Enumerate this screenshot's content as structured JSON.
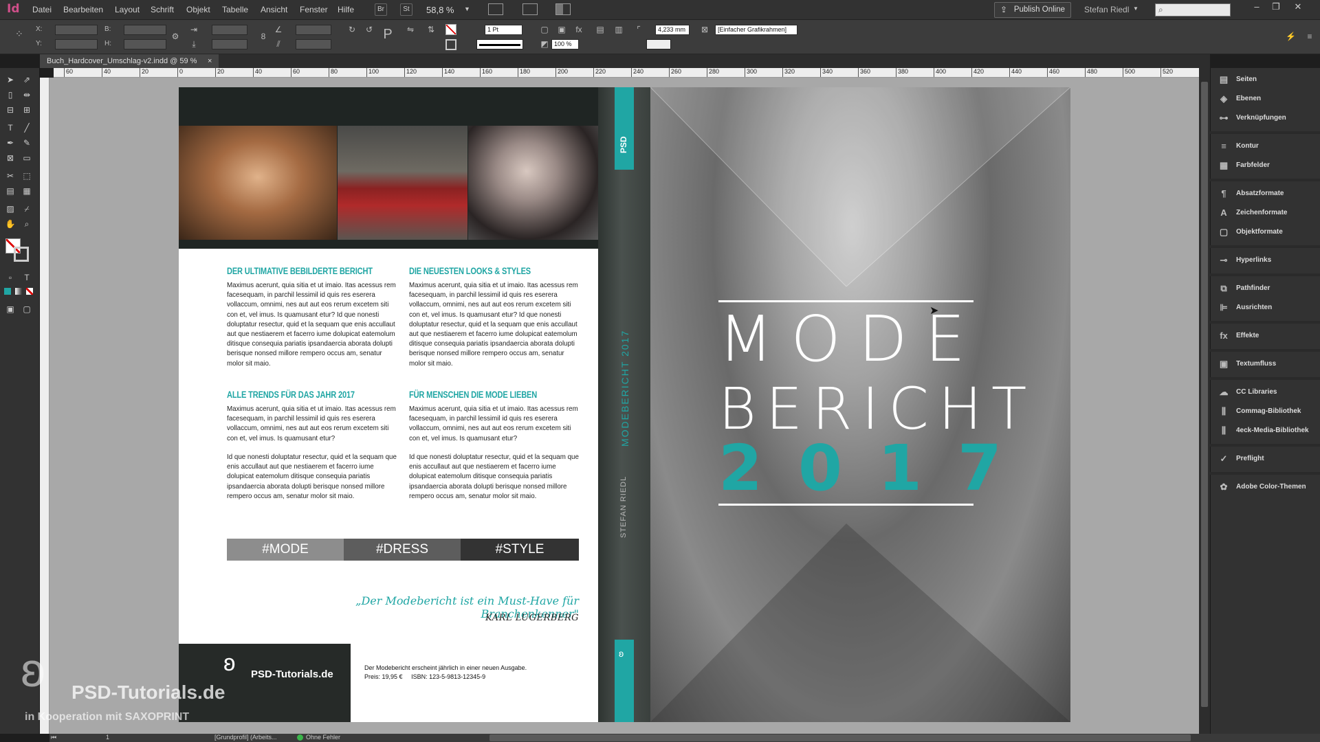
{
  "app": {
    "logo": "Id"
  },
  "menu": [
    "Datei",
    "Bearbeiten",
    "Layout",
    "Schrift",
    "Objekt",
    "Tabelle",
    "Ansicht",
    "Fenster",
    "Hilfe"
  ],
  "menubar": {
    "br_label": "Br",
    "st_label": "St",
    "zoom": "58,8 %",
    "publish": "Publish Online",
    "user": "Stefan Riedl"
  },
  "controlbar": {
    "x_label": "X:",
    "y_label": "Y:",
    "b_label": "B:",
    "h_label": "H:",
    "stroke_weight": "1 Pt",
    "dimension": "4,233 mm",
    "percent": "100 %",
    "frame_style": "[Einfacher Grafikrahmen]"
  },
  "document_tab": {
    "title": "Buch_Hardcover_Umschlag-v2.indd @ 59 %"
  },
  "ruler": {
    "ticks": [
      "60",
      "40",
      "20",
      "0",
      "20",
      "40",
      "60",
      "80",
      "100",
      "120",
      "140",
      "160",
      "180",
      "200",
      "220",
      "240",
      "260",
      "280",
      "300",
      "320",
      "340",
      "360",
      "380",
      "400",
      "420",
      "440",
      "460",
      "480",
      "500",
      "520"
    ]
  },
  "panel": {
    "items": [
      "Seiten",
      "Ebenen",
      "Verknüpfungen",
      "Kontur",
      "Farbfelder",
      "Absatzformate",
      "Zeichenformate",
      "Objektformate",
      "Hyperlinks",
      "Pathfinder",
      "Ausrichten",
      "Effekte",
      "Textumfluss",
      "CC Libraries",
      "Commag-Bibliothek",
      "4eck-Media-Bibliothek",
      "Preflight",
      "Adobe Color-Themen"
    ]
  },
  "back_cover": {
    "col1": {
      "h1": "DER ULTIMATIVE BEBILDERTE BERICHT",
      "p1": "Maximus acerunt, quia sitia et ut imaio. Itas acessus rem facesequam, in parchil lessimil id quis res eserera vollaccum, omnimi, nes aut aut eos rerum excetem siti con et, vel imus. Is quamusant etur? Id que nonesti doluptatur resectur, quid et la sequam que enis accullaut aut que nestiaerem et facerro iume dolupicat eatemolum ditisque consequia pariatis ipsandaercia aborata dolupti berisque nonsed millore rempero occus am, senatur molor sit maio.",
      "h2": "ALLE TRENDS FÜR DAS JAHR 2017",
      "p2": "Maximus acerunt, quia sitia et ut imaio. Itas acessus rem facesequam, in parchil lessimil id quis res eserera vollaccum, omnimi, nes aut aut eos rerum excetem siti con et, vel imus. Is quamusant etur?",
      "p3": "Id que nonesti doluptatur resectur, quid et la sequam que enis accullaut aut que nestiaerem et facerro iume dolupicat eatemolum ditisque consequia pariatis ipsandaercia aborata dolupti berisque nonsed millore rempero occus am, senatur molor sit maio."
    },
    "col2": {
      "h1": "DIE NEUESTEN LOOKS & STYLES",
      "p1": "Maximus acerunt, quia sitia et ut imaio. Itas acessus rem facesequam, in parchil lessimil id quis res eserera vollaccum, omnimi, nes aut aut eos rerum excetem siti con et, vel imus. Is quamusant etur? Id que nonesti doluptatur resectur, quid et la sequam que enis accullaut aut que nestiaerem et facerro iume dolupicat eatemolum ditisque consequia pariatis ipsandaercia aborata dolupti berisque nonsed millore rempero occus am, senatur molor sit maio.",
      "h2": "FÜR MENSCHEN DIE MODE LIEBEN",
      "p2": "Maximus acerunt, quia sitia et ut imaio. Itas acessus rem facesequam, in parchil lessimil id quis res eserera vollaccum, omnimi, nes aut aut eos rerum excetem siti con et, vel imus. Is quamusant etur?",
      "p3": "Id que nonesti doluptatur resectur, quid et la sequam que enis accullaut aut que nestiaerem et facerro iume dolupicat eatemolum ditisque consequia pariatis ipsandaercia aborata dolupti berisque nonsed millore rempero occus am, senatur molor sit maio."
    },
    "tags": [
      "#MODE",
      "#DRESS",
      "#STYLE"
    ],
    "quote": "„Der Modebericht ist ein Must-Have für Branchenkenner\"",
    "quote_author": "KARL LUGERBERG",
    "brand": "PSD-Tutorials.de",
    "footer_line1": "Der Modebericht erscheint jährlich in einer neuen Ausgabe.",
    "footer_price": "Preis: 19,95 €",
    "footer_isbn": "ISBN: 123-5-9813-12345-9"
  },
  "spine": {
    "top": "PSD",
    "title": "MODEBERICHT 2017",
    "author": "STEFAN RIEDL"
  },
  "front_cover": {
    "line1": "MODE",
    "line2": "BERICHT",
    "year": "2017"
  },
  "watermark": {
    "brand": "PSD-Tutorials.de",
    "sub": "in Kooperation mit SAXOPRINT"
  },
  "statusbar": {
    "page": "1",
    "profile": "[Grundprofil] (Arbeits...",
    "errors": "Ohne Fehler"
  },
  "colors": {
    "accent": "#20a6a4",
    "app_bg": "#323232",
    "logo": "#d04f8a"
  }
}
